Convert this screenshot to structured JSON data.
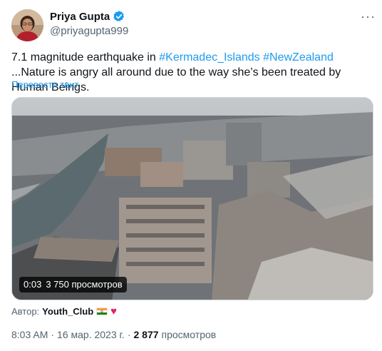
{
  "user": {
    "display_name": "Priya Gupta",
    "handle": "@priyagupta999",
    "verified": true
  },
  "tweet": {
    "text_before": "7.1 magnitude earthquake in ",
    "hashtag_1": "#Kermadec_Islands",
    "space": " ",
    "hashtag_2": "#NewZealand",
    "text_after": " ...Nature is angry all around due to the way she’s been treated by Human Beings.",
    "translate_label": "Перевести твит"
  },
  "video": {
    "duration": "0:03",
    "views": "3 750 просмотров"
  },
  "attribution": {
    "prefix": "Автор:",
    "user": "Youth_Club",
    "emoji_flag": "india-flag-icon",
    "emoji_heart": "♥"
  },
  "meta": {
    "time": "8:03 AM",
    "sep": "·",
    "date": "16 мар. 2023 г.",
    "views_count": "2 877",
    "views_label": "просмотров"
  },
  "colors": {
    "link": "#1d9bf0",
    "muted": "#536471",
    "text": "#0f1419",
    "verified": "#1d9bf0"
  }
}
